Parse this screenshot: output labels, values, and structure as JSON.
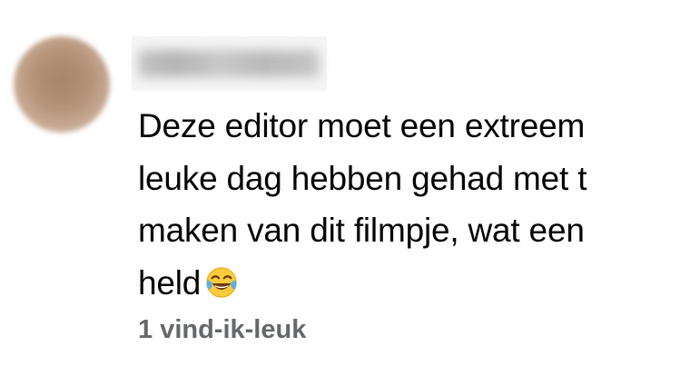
{
  "comment": {
    "author_name": "",
    "text_lines": [
      "Deze editor moet een extreem",
      "leuke dag hebben gehad met t",
      "maken van dit filmpje, wat een",
      "held"
    ],
    "emoji": "face-with-tears-of-joy",
    "likes_label": "1 vind-ik-leuk"
  }
}
